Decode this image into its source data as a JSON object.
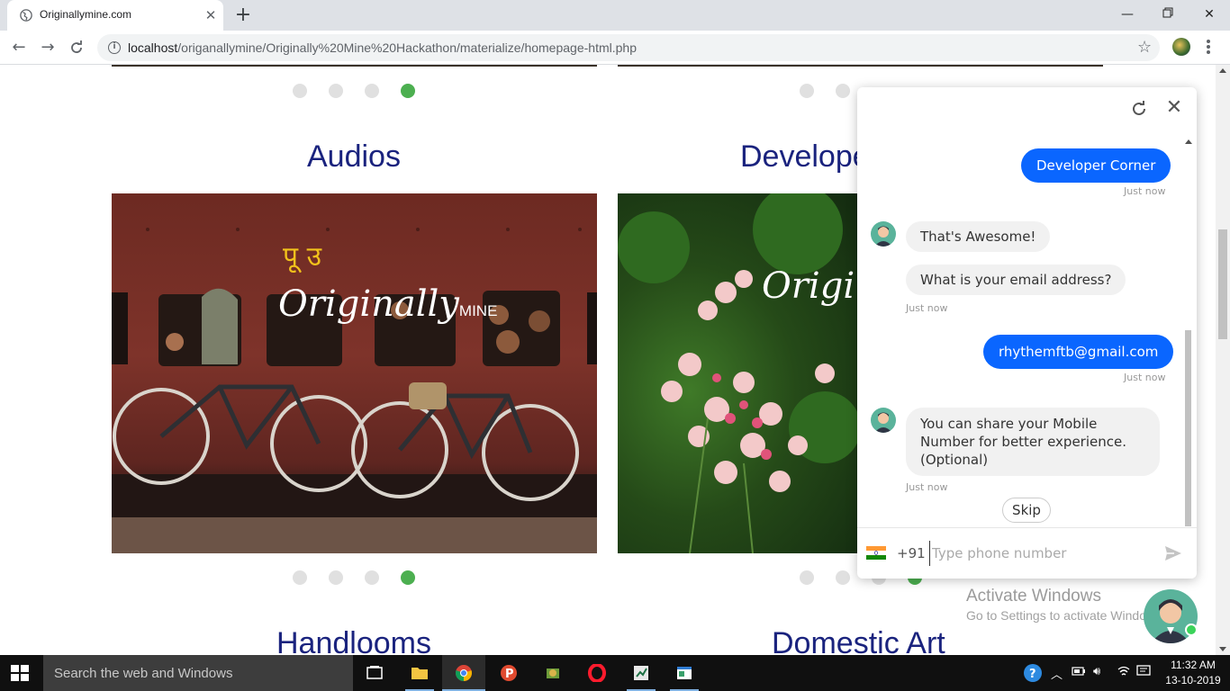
{
  "browser": {
    "tab_title": "Originallymine.com",
    "new_tab_label": "+",
    "url_host": "localhost",
    "url_path": "/origanallymine/Originally%20Mine%20Hackathon/materialize/homepage-html.php"
  },
  "page": {
    "sections": [
      {
        "title": "Audios",
        "image": "train-with-bicycles-photo"
      },
      {
        "title": "Develope",
        "image": "pink-flowers-photo"
      },
      {
        "title": "Handlooms"
      },
      {
        "title": "Domestic Art"
      }
    ],
    "watermark": {
      "script": "Originally",
      "word": "MINE"
    },
    "train_sign": "पू उ",
    "carousel_active_index": 3
  },
  "chat": {
    "messages": [
      {
        "from": "user",
        "text": "Developer Corner",
        "time": "Just now"
      },
      {
        "from": "bot",
        "text": "That's Awesome!"
      },
      {
        "from": "bot",
        "text": "What is your email address?",
        "time": "Just now"
      },
      {
        "from": "user",
        "text": "rhythemftb@gmail.com",
        "time": "Just now"
      },
      {
        "from": "bot",
        "text": "You can share your Mobile Number for better experience. (Optional)",
        "time": "Just now"
      }
    ],
    "skip_label": "Skip",
    "dial_code": "+91",
    "phone_placeholder": "Type phone number",
    "colors": {
      "user_bubble": "#0a66ff",
      "bot_bubble": "#f1f1f1",
      "online": "#3bd35a"
    }
  },
  "activation": {
    "title": "Activate Windows",
    "subtitle": "Go to Settings to activate Windows."
  },
  "taskbar": {
    "search_placeholder": "Search the web and Windows",
    "time": "11:32 AM",
    "date": "13-10-2019"
  },
  "colors": {
    "section_title": "#1a237e",
    "carousel_active": "#4caf50",
    "carousel_inactive": "#e0e0e0"
  }
}
